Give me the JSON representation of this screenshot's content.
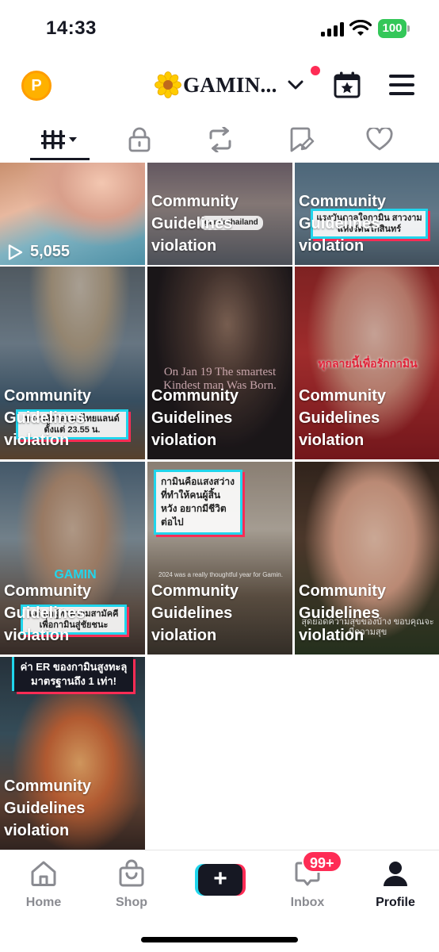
{
  "status_bar": {
    "time": "14:33",
    "battery": "100"
  },
  "header": {
    "coin_letter": "P",
    "account_name": "GAMIN...",
    "account_emoji": "flower-icon",
    "notification_dot": true
  },
  "tabs": [
    {
      "name": "videos-grid-icon",
      "active": true
    },
    {
      "name": "lock-icon",
      "active": false
    },
    {
      "name": "repost-icon",
      "active": false
    },
    {
      "name": "favorites-icon",
      "active": false
    },
    {
      "name": "heart-icon",
      "active": false
    }
  ],
  "posts": [
    {
      "caption": "",
      "views": "5,055",
      "card": "",
      "overlay": ""
    },
    {
      "caption": "Community\nGuidelines\nviolation",
      "views": "",
      "card": "",
      "overlay": "gaminthailand"
    },
    {
      "caption": "Community\nGuidelines\nviolation",
      "views": "",
      "card": "แรงบันดาลใจกามิน\nสาวงามแห่งรัตนโกสินทร์",
      "overlay": ""
    },
    {
      "caption": "Community\nGuidelines\nviolation",
      "views": "",
      "card": "ทรงพลังกลับมาไทยแลนด์\nตั้งแต่ 23.55 น.",
      "overlay": ""
    },
    {
      "caption": "Community\nGuidelines\nviolation",
      "views": "",
      "card": "",
      "overlay": "On Jan 19\nThe smartest\nKindest man\nWas Born."
    },
    {
      "caption": "Community\nGuidelines\nviolation",
      "views": "",
      "card": "",
      "overlay": "ทุกลายนี้เพื่อรักกามิน"
    },
    {
      "caption": "Community\nGuidelines\nviolation",
      "views": "",
      "card": "แด่เธอผู้ทำความสามัคคี\nเพื่อกามินสู่ชัยชนะ",
      "overlay": "GAMIN"
    },
    {
      "caption": "Community\nGuidelines\nviolation",
      "views": "",
      "card": "กามินคือแสงสว่าง\nที่ทำให้คนผู้สิ้นหวัง\nอยากมีชีวิตต่อไป",
      "overlay": "2024 was a really thoughtful year for Gamin."
    },
    {
      "caption": "Community\nGuidelines\nviolation",
      "views": "",
      "card": "",
      "overlay": "สุดยอดความสุขของบ้าง\nขอบคุณจะมีความสุข"
    },
    {
      "caption": "Community\nGuidelines\nviolation",
      "views": "",
      "card": "ค่า ER ของกามินสูงทะลุ\nมาตรฐานถึง 1 เท่า!",
      "overlay": ""
    }
  ],
  "bottom_nav": {
    "home_label": "Home",
    "shop_label": "Shop",
    "create_label": "+",
    "inbox_label": "Inbox",
    "inbox_badge": "99+",
    "profile_label": "Profile"
  }
}
